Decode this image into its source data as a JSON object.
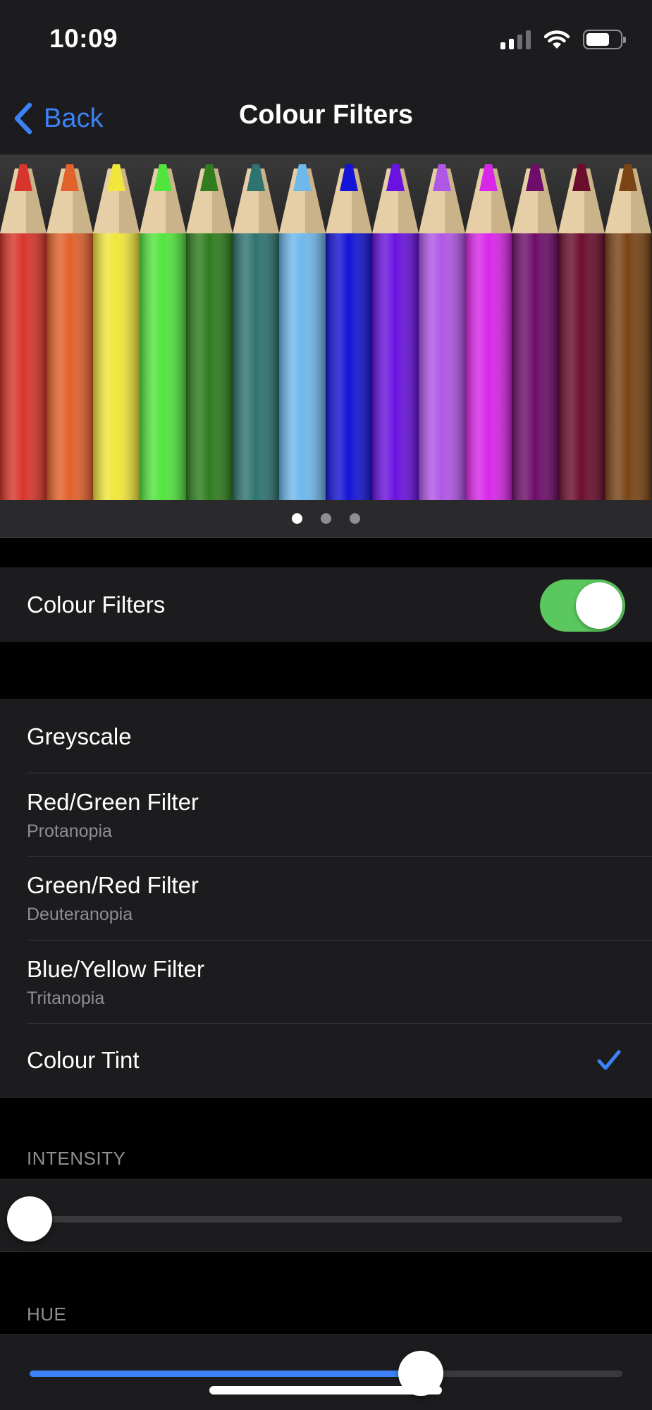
{
  "status_bar": {
    "time": "10:09",
    "signal_bars": 4,
    "signal_active": 2,
    "battery_level": 0.7
  },
  "nav": {
    "back_label": "Back",
    "title": "Colour Filters"
  },
  "pencils": {
    "colors": [
      "#d8352c",
      "#e1622b",
      "#f0e63c",
      "#52e43e",
      "#2f7d1f",
      "#2f7370",
      "#6fb8ec",
      "#1414d6",
      "#6a12e0",
      "#b157e6",
      "#d927e8",
      "#6e0d6a",
      "#6b0e2e",
      "#7a4416"
    ],
    "pages": 3,
    "active_page": 0
  },
  "colour_filters_toggle": {
    "label": "Colour Filters",
    "on": true,
    "on_color": "#5ac85e"
  },
  "filters": [
    {
      "label": "Greyscale",
      "sub": ""
    },
    {
      "label": "Red/Green Filter",
      "sub": "Protanopia"
    },
    {
      "label": "Green/Red Filter",
      "sub": "Deuteranopia"
    },
    {
      "label": "Blue/Yellow Filter",
      "sub": "Tritanopia"
    },
    {
      "label": "Colour Tint",
      "sub": "",
      "selected": true
    }
  ],
  "intensity": {
    "header": "INTENSITY",
    "value": 0.0
  },
  "hue": {
    "header": "HUE",
    "value": 0.66
  },
  "accent_color": "#3b82f6"
}
